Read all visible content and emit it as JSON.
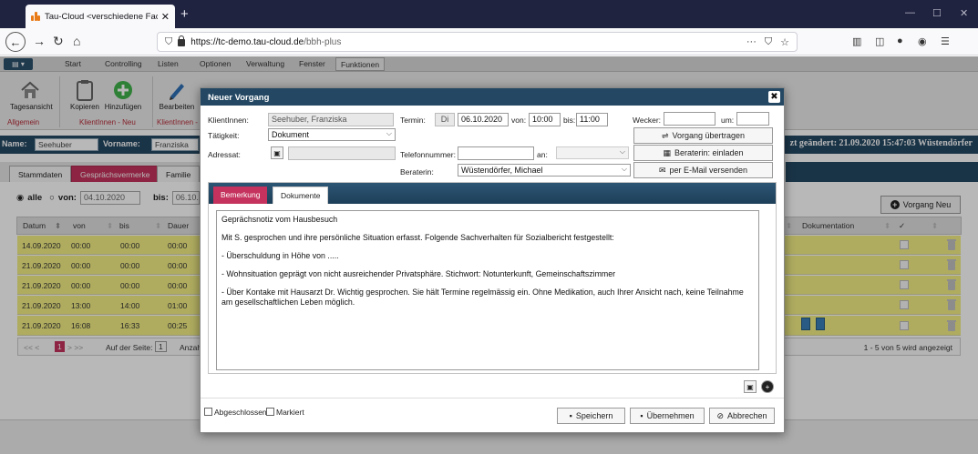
{
  "browser": {
    "tab_title": "Tau-Cloud <verschiedene Fach",
    "url_host": "https://tc-demo.tau-cloud.de",
    "url_path": "/bbh-plus",
    "url_more": "···"
  },
  "menu": {
    "app_label": "▤ ▾",
    "items": [
      "Start",
      "Controlling",
      "Listen",
      "Optionen",
      "Verwaltung",
      "Fenster",
      "Funktionen"
    ]
  },
  "ribbon": {
    "buttons": [
      "Tagesansicht",
      "Kopieren",
      "Hinzufügen",
      "Bearbeiten"
    ],
    "groups": [
      "Allgemein",
      "KlientInnen - Neu",
      "KlientInnen -"
    ]
  },
  "customer": {
    "name_label": "Name:",
    "name_value": "Seehuber",
    "vorname_label": "Vorname:",
    "vorname_value": "Franziska",
    "changed": "zt geändert: 21.09.2020 15:47:03 Wüstendörfer"
  },
  "main_tabs": [
    "Stammdaten",
    "Gesprächsvermerke",
    "Familie"
  ],
  "filter": {
    "alle": "alle",
    "von_label": "von:",
    "von_value": "04.10.2020",
    "bis_label": "bis:",
    "bis_value": "06.10."
  },
  "new_button": "Vorgang Neu",
  "table": {
    "headers": [
      "Datum",
      "von",
      "bis",
      "Dauer",
      "Dokumentation",
      "✓"
    ],
    "rows": [
      {
        "datum": "14.09.2020",
        "von": "00:00",
        "bis": "00:00",
        "dauer": "00:00"
      },
      {
        "datum": "21.09.2020",
        "von": "00:00",
        "bis": "00:00",
        "dauer": "00:00"
      },
      {
        "datum": "21.09.2020",
        "von": "00:00",
        "bis": "00:00",
        "dauer": "00:00"
      },
      {
        "datum": "21.09.2020",
        "von": "13:00",
        "bis": "14:00",
        "dauer": "01:00"
      },
      {
        "datum": "21.09.2020",
        "von": "16:08",
        "bis": "16:33",
        "dauer": "00:25"
      }
    ],
    "pager_left": "<< < 1 > >>",
    "pager_per_page": "Auf der Seite:",
    "pager_count": "1",
    "pager_anz": "Anzah",
    "pager_right": "1 - 5 von 5 wird angezeigt"
  },
  "modal": {
    "title": "Neuer Vorgang",
    "klientinnen_label": "KlientInnen:",
    "klientinnen_value": "Seehuber, Franziska",
    "termin_label": "Termin:",
    "termin_day": "Di",
    "termin_date": "06.10.2020",
    "von_label": "von:",
    "von_value": "10:00",
    "bis_label": "bis:",
    "bis_value": "11:00",
    "wecker_label": "Wecker:",
    "wecker_value": "",
    "um_label": "um:",
    "um_value": "",
    "taetigkeit_label": "Tätigkeit:",
    "taetigkeit_value": "Dokument",
    "adressat_label": "Adressat:",
    "telefon_label": "Telefonnummer:",
    "telefon_value": "",
    "an_label": "an:",
    "an_value": "",
    "beraterin_label": "Beraterin:",
    "beraterin_value": "Wüstendörfer, Michael",
    "btn_transfer": "Vorgang übertragen",
    "btn_invite": "Beraterin: einladen",
    "btn_email": "per E-Mail versenden",
    "tab_bemerkung": "Bemerkung",
    "tab_dokumente": "Dokumente",
    "notes": [
      "Geprächsnotiz vom Hausbesuch",
      "Mit S. gesprochen und ihre persönliche Situation erfasst. Folgende Sachverhalten für Sozialbericht festgestellt:",
      "- Überschuldung in Höhe von .....",
      "- Wohnsituation geprägt von nicht ausreichender Privatsphäre. Stichwort: Notunterkunft, Gemeinschaftszimmer",
      "- Über Kontake mit Hausarzt Dr. Wichtig gesprochen. Sie hält Termine regelmässig ein. Ohne Medikation, auch Ihrer Ansicht nach, keine Teilnahme am gesellschaftlichen Leben möglich."
    ],
    "abgeschlossen": "Abgeschlossen",
    "markiert": "Markiert",
    "btn_save": "Speichern",
    "btn_apply": "Übernehmen",
    "btn_cancel": "Abbrechen"
  },
  "colors": {
    "accent_red": "#c5325d",
    "navy": "#244863",
    "row_yellow": "#f3ef85"
  }
}
